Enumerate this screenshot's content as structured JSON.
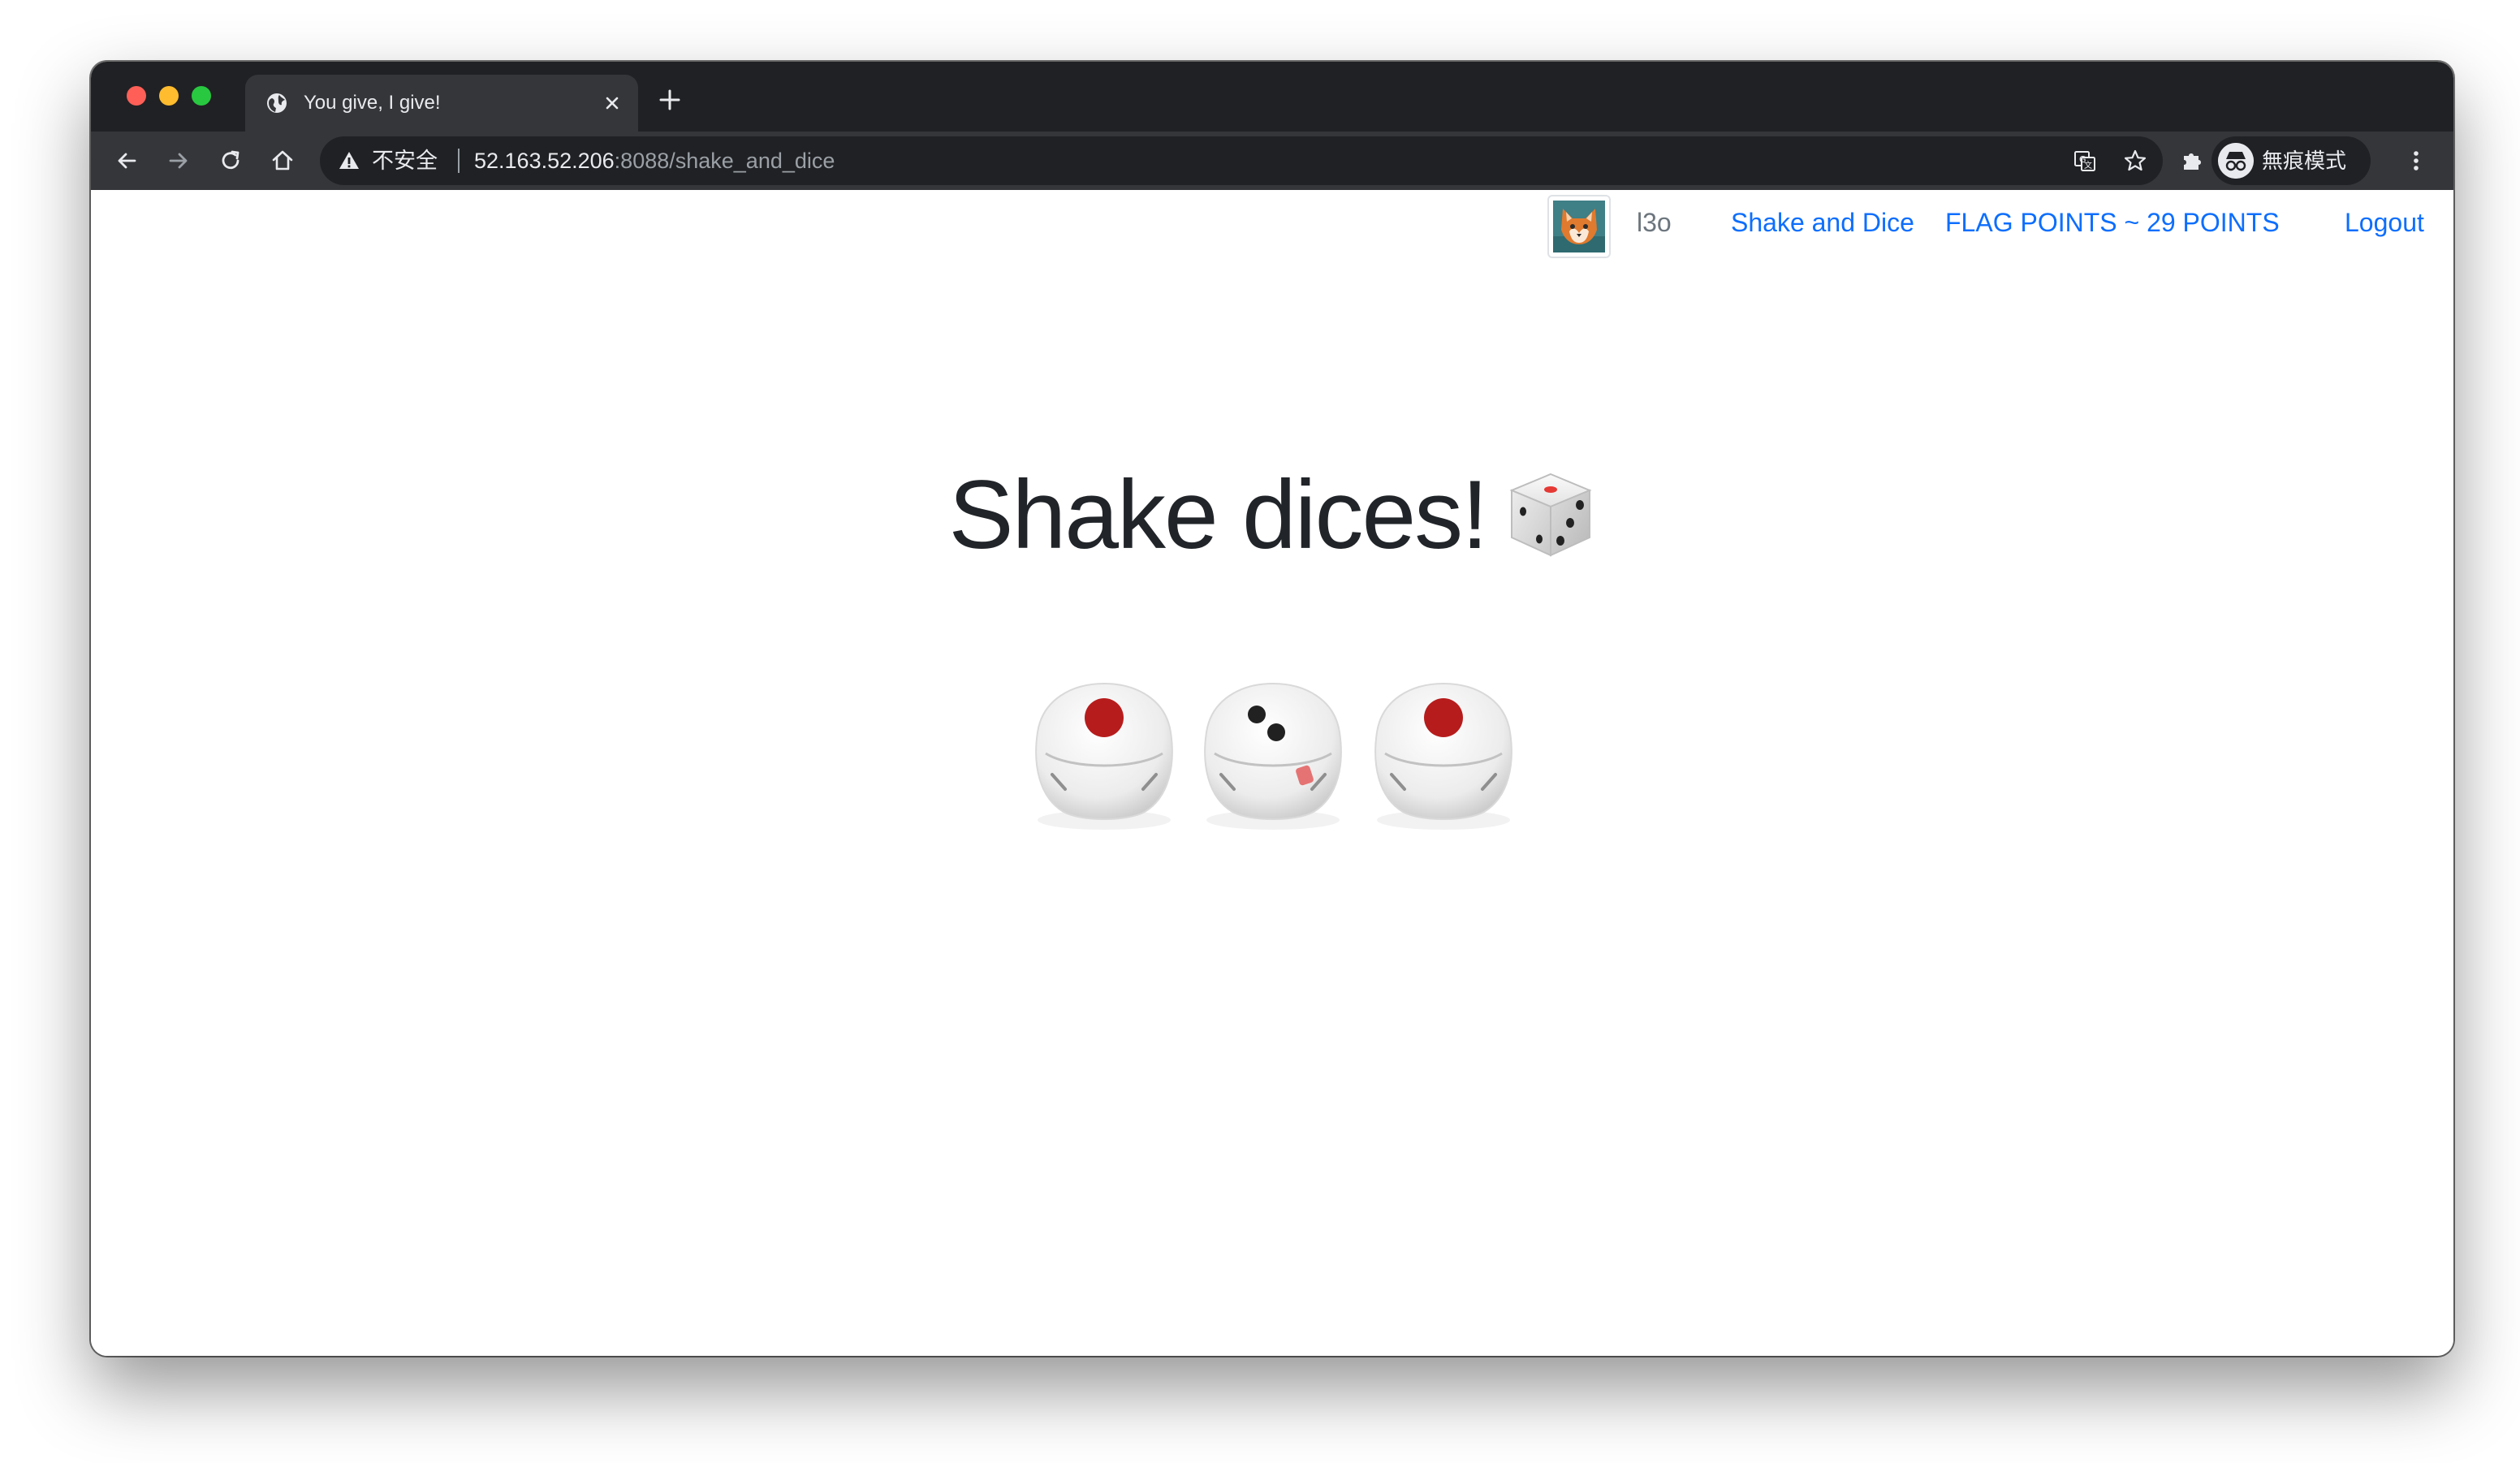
{
  "browser": {
    "tab": {
      "title": "You give, I give!",
      "favicon": "globe-icon"
    },
    "toolbar": {
      "security_label": "不安全",
      "url_host": "52.163.52.206",
      "url_path": ":8088/shake_and_dice",
      "profile_label": "無痕模式"
    },
    "colors": {
      "frame": "#202124",
      "toolbar": "#35363a",
      "omnibox": "#202124",
      "text": "#e8eaed",
      "muted_text": "#9aa0a6"
    }
  },
  "navbar": {
    "avatar_icon": "fox-avatar-icon",
    "username": "l3o",
    "shake_link": "Shake and Dice",
    "flag_points": "FLAG POINTS ~ 29 POINTS",
    "logout": "Logout",
    "link_color": "#0d6efd"
  },
  "main": {
    "title": "Shake dices!",
    "title_icon": "game-die-icon",
    "dice": [
      {
        "face": 1,
        "pip_color": "#b71c1c"
      },
      {
        "face": 2,
        "pip_color": "#212121"
      },
      {
        "face": 1,
        "pip_color": "#b71c1c"
      }
    ]
  }
}
